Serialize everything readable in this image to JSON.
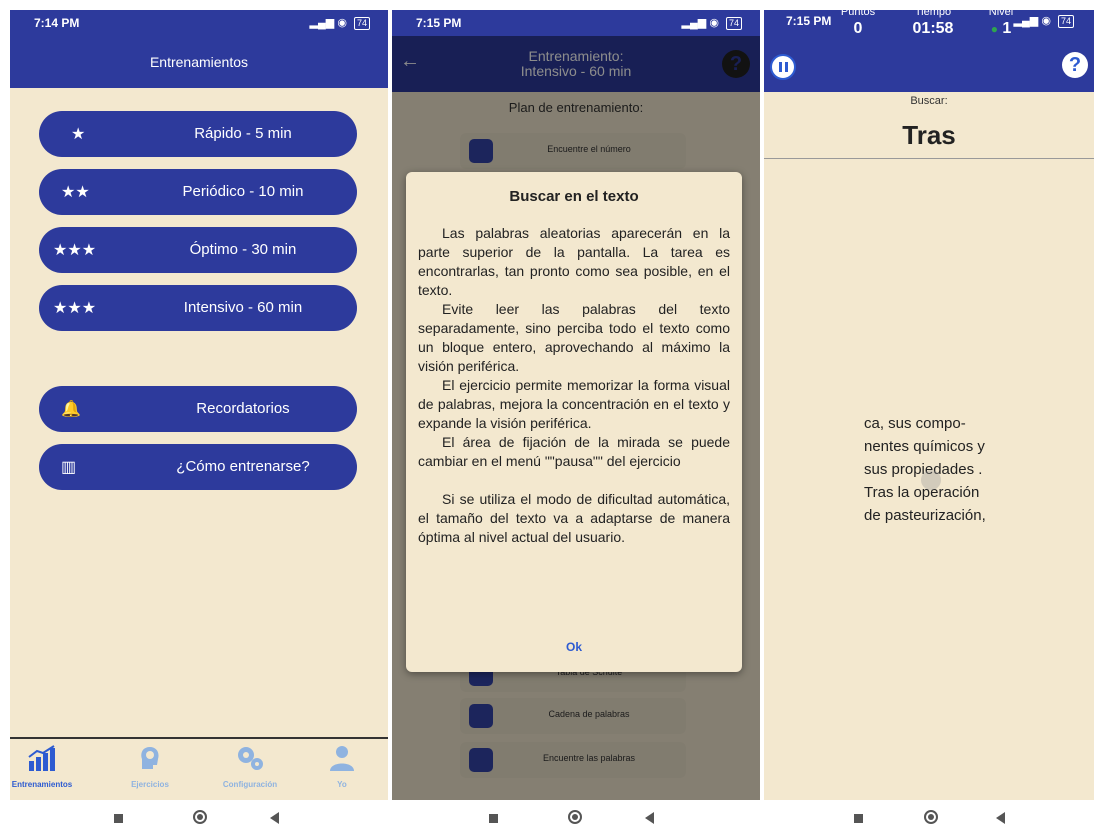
{
  "nav": {
    "square": "square-nav-icon",
    "circle": "home-nav-icon",
    "back": "back-nav-icon"
  },
  "phone1": {
    "time": "7:14 PM",
    "battery": "74",
    "title": "Entrenamientos",
    "buttons": [
      {
        "icon": "★",
        "label": "Rápido - 5 min"
      },
      {
        "icon": "★★",
        "label": "Periódico - 10 min"
      },
      {
        "icon": "★★★",
        "label": "Óptimo - 30 min"
      },
      {
        "icon": "★★★",
        "label": "Intensivo - 60 min"
      },
      {
        "icon": "🔔",
        "label": "Recordatorios"
      },
      {
        "icon": "▥",
        "label": "¿Cómo entrenarse?"
      }
    ],
    "tabs": [
      {
        "label": "Entrenamientos",
        "icon": "chart-icon"
      },
      {
        "label": "Ejercicios",
        "icon": "head-icon"
      },
      {
        "label": "Configuración",
        "icon": "gears-icon"
      },
      {
        "label": "Yo",
        "icon": "user-icon"
      }
    ]
  },
  "phone2": {
    "time": "7:15 PM",
    "battery": "74",
    "title_line1": "Entrenamiento:",
    "title_line2": "Intensivo - 60 min",
    "plan_label": "Plan de entrenamiento:",
    "plan_items": [
      "Encuentre el número",
      "Tabla de Schulte",
      "Cadena de palabras",
      "Encuentre las palabras"
    ],
    "dialog": {
      "title": "Buscar en el texto",
      "p1": "Las palabras aleatorias aparecerán en la parte superior de la pantalla. La tarea es encontrarlas, tan pronto como sea posible, en el texto.",
      "p2": "Evite leer las palabras del texto separadamente, sino perciba todo el texto como un bloque entero, aprovechando al máximo la visión periférica.",
      "p3": "El ejercicio permite memorizar la forma visual de palabras, mejora la concentración en el texto y expande la visión periférica.",
      "p4": "El área de fijación de la mirada se puede cambiar en el menú \"\"pausa\"\" del ejercicio",
      "p5": "Si se utiliza el modo de dificultad automática, el tamaño del texto va a adaptarse de manera óptima al nivel actual del usuario.",
      "ok": "Ok"
    }
  },
  "phone3": {
    "time": "7:15 PM",
    "battery": "74",
    "puntos_label": "Puntos",
    "puntos_value": "0",
    "tiempo_label": "Tiempo",
    "tiempo_value": "01:58",
    "nivel_label": "Nivel",
    "nivel_value": "1",
    "buscar_label": "Buscar:",
    "target_word": "Tras",
    "text_lines": [
      "ca, sus compo-",
      "nentes químicos y",
      "sus propiedades .",
      "Tras la operación",
      "de pasteurización,"
    ]
  }
}
